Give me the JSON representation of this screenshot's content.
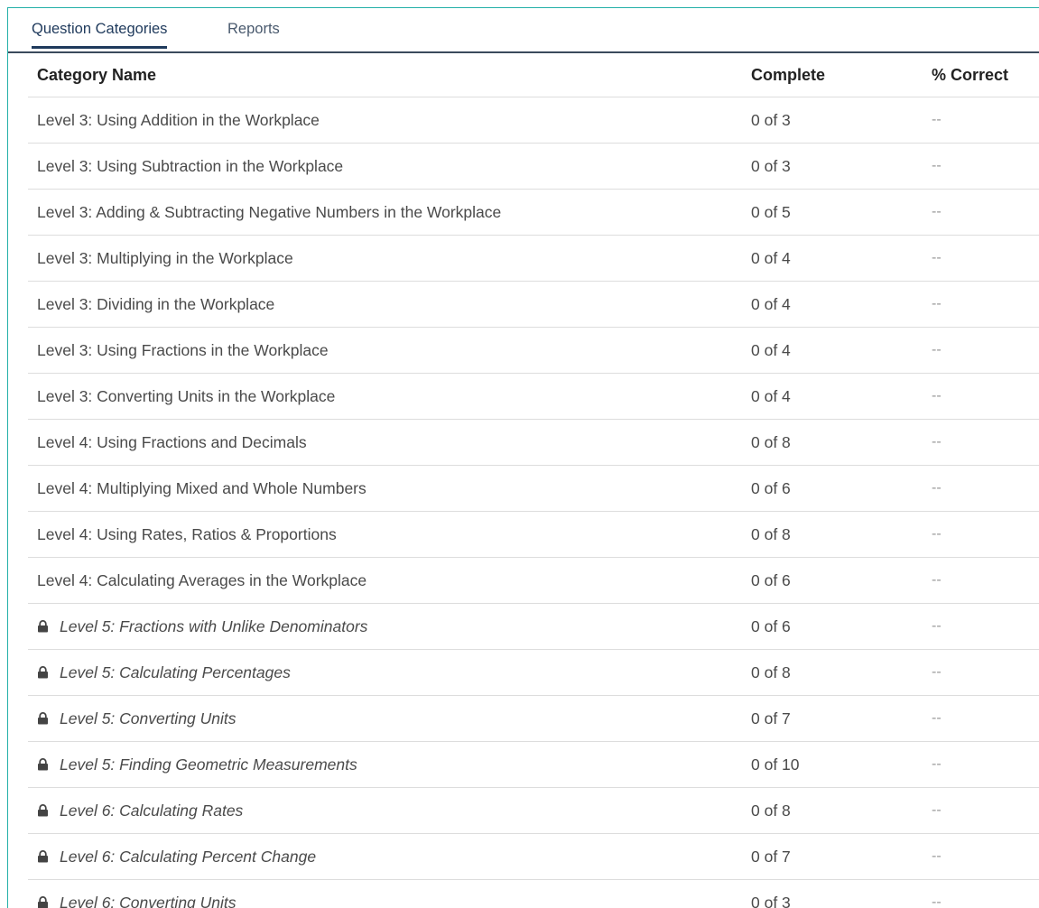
{
  "tabs": [
    {
      "label": "Question Categories",
      "active": true
    },
    {
      "label": "Reports",
      "active": false
    }
  ],
  "table": {
    "headers": {
      "name": "Category Name",
      "complete": "Complete",
      "correct": "% Correct"
    },
    "rows": [
      {
        "name": "Level 3: Using Addition in the Workplace",
        "complete": "0 of 3",
        "correct": "--",
        "locked": false
      },
      {
        "name": "Level 3: Using Subtraction in the Workplace",
        "complete": "0 of 3",
        "correct": "--",
        "locked": false
      },
      {
        "name": "Level 3: Adding & Subtracting Negative Numbers in the Workplace",
        "complete": "0 of 5",
        "correct": "--",
        "locked": false
      },
      {
        "name": "Level 3: Multiplying in the Workplace",
        "complete": "0 of 4",
        "correct": "--",
        "locked": false
      },
      {
        "name": "Level 3: Dividing in the Workplace",
        "complete": "0 of 4",
        "correct": "--",
        "locked": false
      },
      {
        "name": "Level 3: Using Fractions in the Workplace",
        "complete": "0 of 4",
        "correct": "--",
        "locked": false
      },
      {
        "name": "Level 3: Converting Units in the Workplace",
        "complete": "0 of 4",
        "correct": "--",
        "locked": false
      },
      {
        "name": "Level 4: Using Fractions and Decimals",
        "complete": "0 of 8",
        "correct": "--",
        "locked": false
      },
      {
        "name": "Level 4: Multiplying Mixed and Whole Numbers",
        "complete": "0 of 6",
        "correct": "--",
        "locked": false
      },
      {
        "name": "Level 4: Using Rates, Ratios & Proportions",
        "complete": "0 of 8",
        "correct": "--",
        "locked": false
      },
      {
        "name": "Level 4: Calculating Averages in the Workplace",
        "complete": "0 of 6",
        "correct": "--",
        "locked": false
      },
      {
        "name": "Level 5: Fractions with Unlike Denominators",
        "complete": "0 of 6",
        "correct": "--",
        "locked": true
      },
      {
        "name": "Level 5: Calculating Percentages",
        "complete": "0 of 8",
        "correct": "--",
        "locked": true
      },
      {
        "name": "Level 5: Converting Units",
        "complete": "0 of 7",
        "correct": "--",
        "locked": true
      },
      {
        "name": "Level 5: Finding Geometric Measurements",
        "complete": "0 of 10",
        "correct": "--",
        "locked": true
      },
      {
        "name": "Level 6: Calculating Rates",
        "complete": "0 of 8",
        "correct": "--",
        "locked": true
      },
      {
        "name": "Level 6: Calculating Percent Change",
        "complete": "0 of 7",
        "correct": "--",
        "locked": true
      },
      {
        "name": "Level 6: Converting Units",
        "complete": "0 of 3",
        "correct": "--",
        "locked": true
      }
    ]
  },
  "icons": {
    "locked_row": "lock-icon"
  },
  "colors": {
    "accent": "#1f3a5c",
    "frame_border": "#23b0a8"
  }
}
